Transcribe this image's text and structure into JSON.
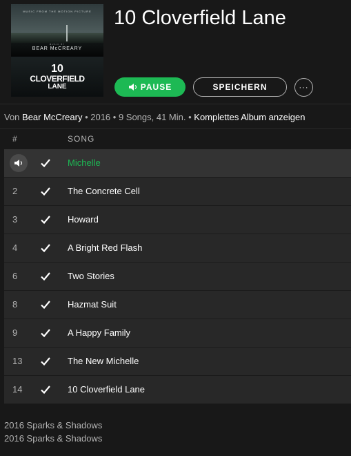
{
  "cover": {
    "tagline": "MUSIC FROM THE MOTION PICTURE",
    "music_by": "MUSIC BY",
    "composer": "BEAR McCREARY",
    "title_line1": "10",
    "title_line2": "CLOVERFIELD",
    "title_line3": "LANE"
  },
  "album": {
    "title": "10 Cloverfield Lane"
  },
  "buttons": {
    "pause": "PAUSE",
    "save": "SPEICHERN",
    "more": "···"
  },
  "meta": {
    "by_prefix": "Von ",
    "artist": "Bear McCreary",
    "year": "2016",
    "songs": "9 Songs, 41 Min.",
    "full_album": "Komplettes Album anzeigen",
    "separator": " • "
  },
  "table": {
    "col_num": "#",
    "col_song": "SONG",
    "rows": [
      {
        "num": "",
        "title": "Michelle"
      },
      {
        "num": "2",
        "title": "The Concrete Cell"
      },
      {
        "num": "3",
        "title": "Howard"
      },
      {
        "num": "4",
        "title": "A Bright Red Flash"
      },
      {
        "num": "6",
        "title": "Two Stories"
      },
      {
        "num": "8",
        "title": "Hazmat Suit"
      },
      {
        "num": "9",
        "title": "A Happy Family"
      },
      {
        "num": "13",
        "title": "The New Michelle"
      },
      {
        "num": "14",
        "title": "10 Cloverfield Lane"
      }
    ]
  },
  "copyright": {
    "line1": "2016 Sparks & Shadows",
    "line2": "2016 Sparks & Shadows"
  },
  "colors": {
    "accent": "#1db954",
    "background": "#181818",
    "row": "#282828"
  }
}
